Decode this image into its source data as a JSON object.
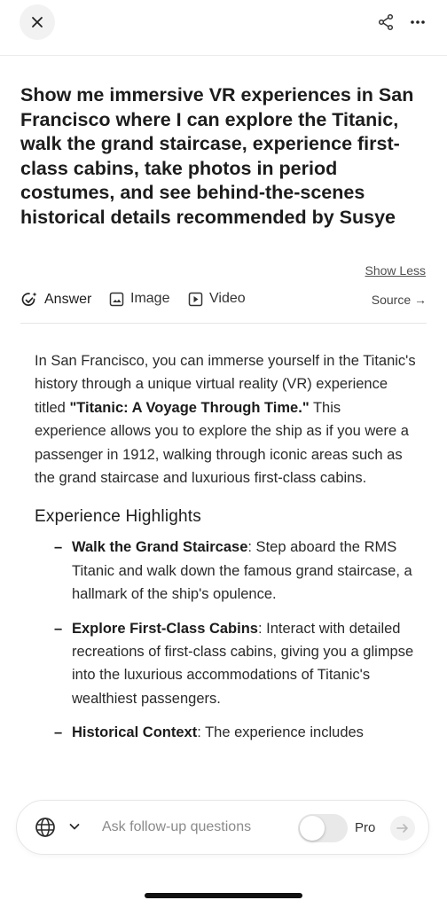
{
  "header": {
    "close_icon": "close-icon",
    "share_icon": "share-icon",
    "more_icon": "more-horizontal-icon"
  },
  "query": {
    "text": "Show me immersive VR experiences in San Francisco where I can explore the Titanic, walk the grand staircase, experience first-class cabins, take photos in period costumes, and see behind-the-scenes historical details recommended by Susye",
    "show_less_label": "Show Less"
  },
  "tabs": [
    {
      "label": "Answer",
      "icon": "answer-sparkle-icon",
      "active": true
    },
    {
      "label": "Image",
      "icon": "image-icon",
      "active": false
    },
    {
      "label": "Video",
      "icon": "video-icon",
      "active": false
    }
  ],
  "source_link": "Source →",
  "answer": {
    "intro_before": "In San Francisco, you can immerse yourself in the Titanic's history through a unique virtual reality (VR) experience titled ",
    "intro_bold": "\"Titanic: A Voyage Through Time.\"",
    "intro_after": " This experience allows you to explore the ship as if you were a passenger in 1912, walking through iconic areas such as the grand staircase and luxurious first-class cabins.",
    "heading": "Experience Highlights",
    "bullets": [
      {
        "title": "Walk the Grand Staircase",
        "text": ": Step aboard the RMS Titanic and walk down the famous grand staircase, a hallmark of the ship's opulence."
      },
      {
        "title": "Explore First-Class Cabins",
        "text": ": Interact with detailed recreations of first-class cabins, giving you a glimpse into the luxurious accommodations of Titanic's wealthiest passengers."
      },
      {
        "title": "Historical Context",
        "text": ": The experience includes"
      }
    ]
  },
  "composer": {
    "language_icon": "globe-icon",
    "placeholder": "Ask follow-up questions",
    "pro_label": "Pro",
    "pro_enabled": false,
    "send_icon": "arrow-right-icon"
  },
  "colors": {
    "text_primary": "#1c1c1c",
    "muted": "#8a8a8a",
    "toggle_off": "#e9e9ea"
  }
}
